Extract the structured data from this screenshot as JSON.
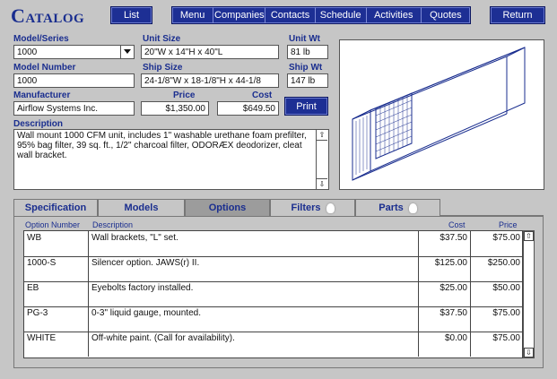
{
  "app": {
    "title": "Catalog"
  },
  "header": {
    "list_label": "List",
    "nav_items": [
      "Menu",
      "Companies",
      "Contacts",
      "Schedule",
      "Activities",
      "Quotes"
    ],
    "return_label": "Return"
  },
  "form": {
    "model_series": {
      "label": "Model/Series",
      "value": "1000"
    },
    "unit_size": {
      "label": "Unit Size",
      "value": "20\"W x 14\"H x 40\"L"
    },
    "unit_wt": {
      "label": "Unit Wt",
      "value": "81 lb"
    },
    "model_number": {
      "label": "Model Number",
      "value": "1000"
    },
    "ship_size": {
      "label": "Ship Size",
      "value": "24-1/8\"W x 18-1/8\"H x 44-1/8"
    },
    "ship_wt": {
      "label": "Ship Wt",
      "value": "147 lb"
    },
    "manufacturer": {
      "label": "Manufacturer",
      "value": "Airflow Systems Inc."
    },
    "price": {
      "label": "Price",
      "value": "$1,350.00"
    },
    "cost": {
      "label": "Cost",
      "value": "$649.50"
    },
    "print_label": "Print",
    "description": {
      "label": "Description",
      "value": "Wall mount 1000 CFM unit, includes 1\" washable urethane foam prefilter, 95% bag filter, 39 sq. ft., 1/2\" charcoal filter, ODORÆX deodorizer, cleat wall bracket."
    }
  },
  "tabs": [
    {
      "label": "Specification",
      "active": false,
      "bulb": false
    },
    {
      "label": "Models",
      "active": false,
      "bulb": false
    },
    {
      "label": "Options",
      "active": true,
      "bulb": false
    },
    {
      "label": "Filters",
      "active": false,
      "bulb": true
    },
    {
      "label": "Parts",
      "active": false,
      "bulb": true
    }
  ],
  "options_table": {
    "headers": {
      "option_number": "Option Number",
      "description": "Description",
      "cost": "Cost",
      "price": "Price"
    },
    "rows": [
      {
        "option": "WB",
        "description": "Wall brackets, \"L\" set.",
        "cost": "$37.50",
        "price": "$75.00"
      },
      {
        "option": "1000-S",
        "description": "Silencer option. JAWS(r) II.",
        "cost": "$125.00",
        "price": "$250.00"
      },
      {
        "option": "EB",
        "description": "Eyebolts factory installed.",
        "cost": "$25.00",
        "price": "$50.00"
      },
      {
        "option": "PG-3",
        "description": "0-3\" liquid gauge, mounted.",
        "cost": "$37.50",
        "price": "$75.00"
      },
      {
        "option": "WHITE",
        "description": "Off-white paint. (Call for availability).",
        "cost": "$0.00",
        "price": "$75.00"
      }
    ]
  },
  "colors": {
    "brand_blue": "#1d2f94",
    "label_blue": "#1a2e8f",
    "background": "#c6c6c6"
  }
}
